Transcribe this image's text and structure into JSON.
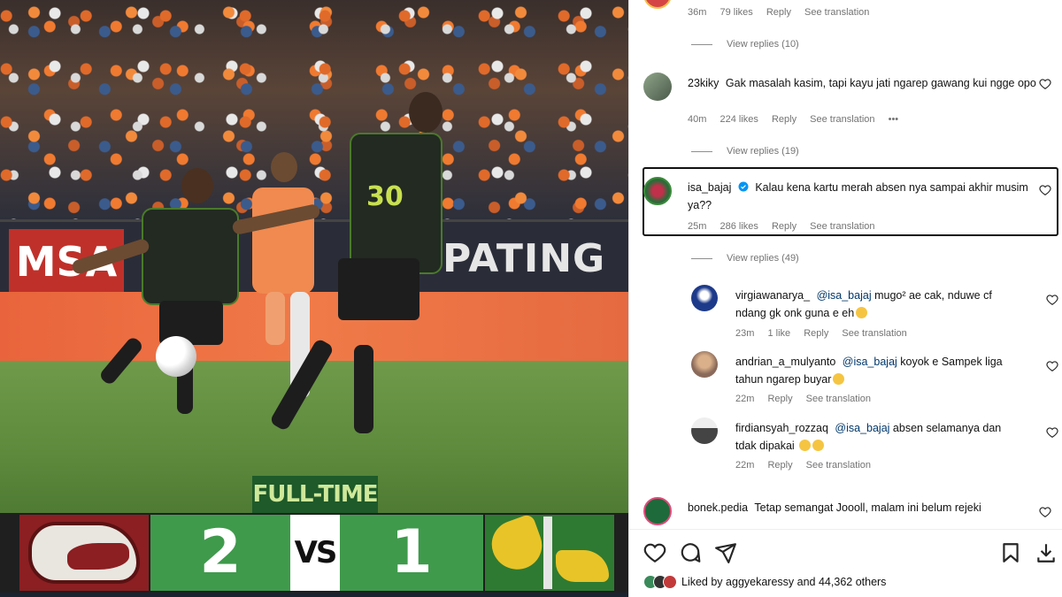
{
  "post_image": {
    "ad_board_left": "MSA",
    "ad_board_right": "PATING",
    "shirt_number": "30",
    "full_time_label": "FULL-TIME",
    "home_score": "2",
    "vs_label": "VS",
    "away_score": "1"
  },
  "comments": {
    "top": {
      "time": "36m",
      "likes": "79 likes",
      "reply": "Reply",
      "see_translation": "See translation",
      "view_replies": "View replies (10)"
    },
    "c1": {
      "user": "23kiky",
      "text": "Gak masalah kasim, tapi kayu jati ngarep gawang kui ngge opo",
      "time": "40m",
      "likes": "224 likes",
      "reply": "Reply",
      "see_translation": "See translation",
      "more": "•••",
      "view_replies": "View replies (19)"
    },
    "c2": {
      "user": "isa_bajaj",
      "text": "Kalau kena kartu merah absen nya sampai akhir musim ya??",
      "time": "25m",
      "likes": "286 likes",
      "reply": "Reply",
      "see_translation": "See translation",
      "view_replies": "View replies (49)"
    },
    "r1": {
      "user": "virgiawanarya_",
      "mention": "@isa_bajaj",
      "text": "mugo² ae cak, nduwe cf ndang gk onk guna e eh",
      "time": "23m",
      "likes": "1 like",
      "reply": "Reply",
      "see_translation": "See translation"
    },
    "r2": {
      "user": "andrian_a_mulyanto",
      "mention": "@isa_bajaj",
      "text": "koyok e Sampek liga tahun ngarep buyar",
      "time": "22m",
      "reply": "Reply",
      "see_translation": "See translation"
    },
    "r3": {
      "user": "firdiansyah_rozzaq",
      "mention": "@isa_bajaj",
      "text": "absen selamanya dan tdak dipakai",
      "time": "22m",
      "reply": "Reply",
      "see_translation": "See translation"
    },
    "c3": {
      "user": "bonek.pedia",
      "text": "Tetap semangat Joooll, malam ini belum rejeki"
    }
  },
  "footer": {
    "liked_by_prefix": "Liked by",
    "liked_by_user": "aggyekaressy",
    "liked_by_suffix": "and 44,362 others"
  },
  "icons": [
    "heart-icon",
    "comment-icon",
    "share-icon",
    "bookmark-icon",
    "download-icon",
    "verified-icon"
  ],
  "colors": {
    "link": "#00376b",
    "meta": "#737373",
    "verified": "#0095f6"
  }
}
